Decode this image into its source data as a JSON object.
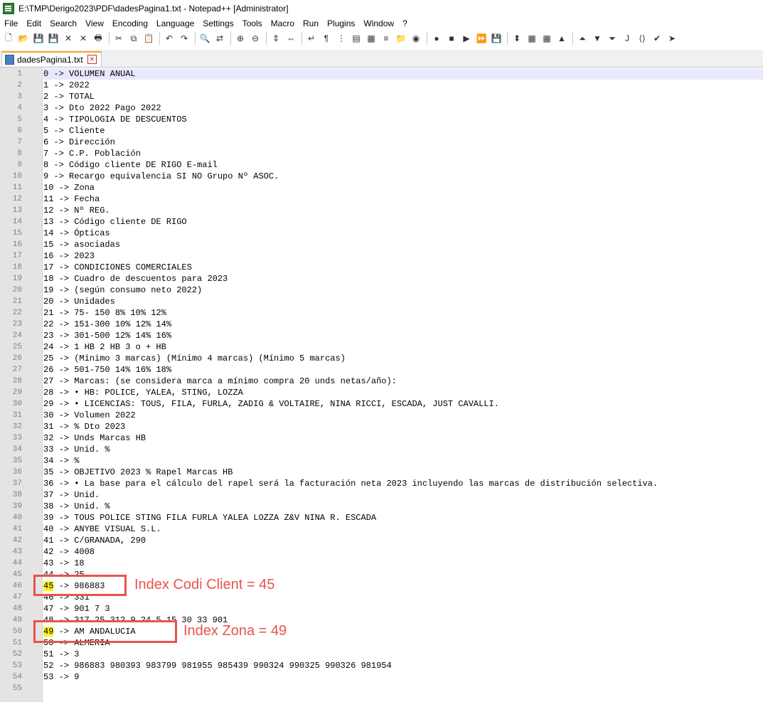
{
  "window": {
    "title": "E:\\TMP\\Derigo2023\\PDF\\dadesPagina1.txt - Notepad++ [Administrator]"
  },
  "menu": [
    "File",
    "Edit",
    "Search",
    "View",
    "Encoding",
    "Language",
    "Settings",
    "Tools",
    "Macro",
    "Run",
    "Plugins",
    "Window",
    "?"
  ],
  "toolbar_icons": [
    "new-file-icon",
    "open-file-icon",
    "save-icon",
    "save-all-icon",
    "close-icon",
    "close-all-icon",
    "print-icon",
    "cut-icon",
    "copy-icon",
    "paste-icon",
    "undo-icon",
    "redo-icon",
    "find-icon",
    "replace-icon",
    "zoom-in-icon",
    "zoom-out-icon",
    "sync-vertical-icon",
    "sync-horizontal-icon",
    "word-wrap-icon",
    "show-all-chars-icon",
    "indent-guide-icon",
    "udl-icon",
    "doc-map-icon",
    "function-list-icon",
    "folder-workspace-icon",
    "monitor-icon",
    "record-macro-icon",
    "stop-record-icon",
    "play-macro-icon",
    "play-multiple-icon",
    "save-macro-icon",
    "insert-line-icon",
    "compare-icon",
    "clear-compare-icon",
    "previous-icon",
    "first-icon",
    "next-icon",
    "last-icon",
    "jstool-icon",
    "json-viewer-icon",
    "spellcheck-icon",
    "misc-icon"
  ],
  "tab": {
    "label": "dadesPagina1.txt"
  },
  "lines": [
    "0 -> VOLUMEN ANUAL",
    "1 -> 2022",
    "2 -> TOTAL",
    "3 -> Dto 2022 Pago 2022",
    "4 -> TIPOLOGIA DE DESCUENTOS",
    "5 -> Cliente",
    "6 -> Dirección",
    "7 -> C.P. Población",
    "8 -> Código cliente DE RIGO E-mail",
    "9 -> Recargo equivalencia SI NO Grupo Nº ASOC.",
    "10 -> Zona",
    "11 -> Fecha",
    "12 -> Nº REG.",
    "13 -> Código cliente DE RIGO",
    "14 -> Ópticas",
    "15 -> asociadas",
    "16 -> 2023",
    "17 -> CONDICIONES COMERCIALES",
    "18 -> Cuadro de descuentos para 2023",
    "19 -> (según consumo neto 2022)",
    "20 -> Unidades",
    "21 -> 75- 150 8% 10% 12%",
    "22 -> 151-300 10% 12% 14%",
    "23 -> 301-500 12% 14% 16%",
    "24 -> 1 HB 2 HB 3 o + HB",
    "25 -> (Mínimo 3 marcas) (Mínimo 4 marcas) (Mínimo 5 marcas)",
    "26 -> 501-750 14% 16% 18%",
    "27 -> Marcas: (se considera marca a mínimo compra 20 unds netas/año):",
    "28 -> • HB: POLICE, YALEA, STING, LOZZA",
    "29 -> • LICENCIAS: TOUS, FILA, FURLA, ZADIG & VOLTAIRE, NINA RICCI, ESCADA, JUST CAVALLI.",
    "30 -> Volumen 2022",
    "31 -> % Dto 2023",
    "32 -> Unds Marcas HB",
    "33 -> Unid. %",
    "34 -> %",
    "35 -> OBJETIVO 2023 % Rapel Marcas HB",
    "36 -> • La base para el cálculo del rapel será la facturación neta 2023 incluyendo las marcas de distribución selectiva.",
    "37 -> Unid.",
    "38 -> Unid. %",
    "39 -> TOUS POLICE STING FILA FURLA YALEA LOZZA Z&V NINA R. ESCADA",
    "40 -> ANYBE VISUAL S.L.",
    "41 -> C/GRANADA, 290",
    "42 -> 4008",
    "43 -> 18",
    "44 -> 25",
    "45 -> 986883",
    "46 -> 331",
    "47 -> 901 7 3",
    "48 -> 317 25 312 9 24 5 15 30 33 901",
    "49 -> AM ANDALUCIA",
    "50 -> ALMERIA",
    "51 -> 3",
    "52 -> 986883 980393 983799 981955 985439 990324 990325 990326 981954",
    "53 -> 9",
    ""
  ],
  "annotations": {
    "codi_client": "Index Codi Client = 45",
    "zona": "Index Zona = 49"
  },
  "colors": {
    "annotation": "#e8544a",
    "highlight": "#f7f227",
    "current_line": "#e8e8ff"
  }
}
